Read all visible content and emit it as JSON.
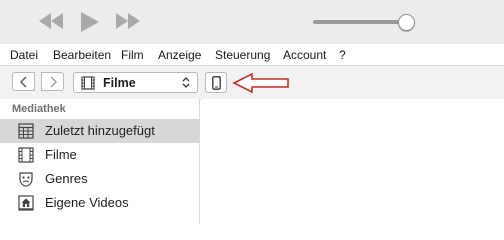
{
  "player": {
    "controls": [
      "rewind-icon",
      "play-icon",
      "fast-forward-icon"
    ],
    "volume_level": 0.94
  },
  "menubar": {
    "items": [
      "Datei",
      "Bearbeiten",
      "Film",
      "Anzeige",
      "Steuerung",
      "Account",
      "?"
    ]
  },
  "navbar": {
    "back_icon": "chevron-left-icon",
    "forward_icon": "chevron-right-icon",
    "media_select": {
      "icon": "film-icon",
      "selected": "Filme"
    },
    "device_icon": "phone-icon",
    "annotation": {
      "icon": "arrow-left-icon",
      "color": "#cc2a2a"
    }
  },
  "sidebar": {
    "heading": "Mediathek",
    "items": [
      {
        "label": "Zuletzt hinzugefügt",
        "icon": "grid-icon",
        "selected": true
      },
      {
        "label": "Filme",
        "icon": "film-icon",
        "selected": false
      },
      {
        "label": "Genres",
        "icon": "masks-icon",
        "selected": false
      },
      {
        "label": "Eigene Videos",
        "icon": "home-video-icon",
        "selected": false
      }
    ]
  },
  "colors": {
    "titlebar_bg": "#ececec",
    "navbar_bg": "#f2f2f2",
    "selected_bg": "#d7d7d7",
    "annotation": "#cc2a2a"
  }
}
